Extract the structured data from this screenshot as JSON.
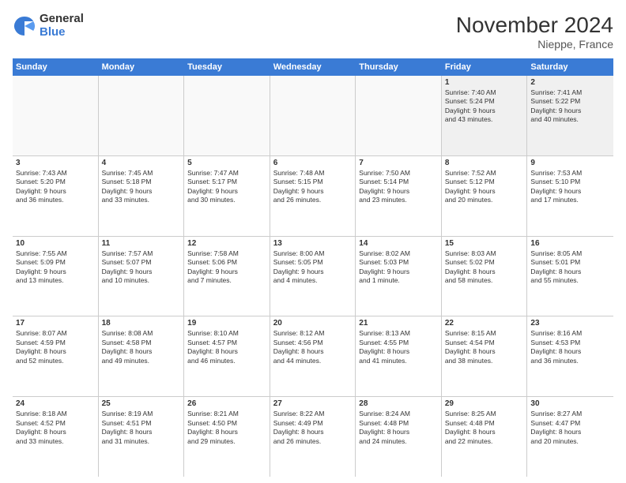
{
  "logo": {
    "general": "General",
    "blue": "Blue"
  },
  "title": "November 2024",
  "subtitle": "Nieppe, France",
  "header": {
    "days": [
      "Sunday",
      "Monday",
      "Tuesday",
      "Wednesday",
      "Thursday",
      "Friday",
      "Saturday"
    ]
  },
  "weeks": [
    {
      "cells": [
        {
          "day": "",
          "info": "",
          "empty": true
        },
        {
          "day": "",
          "info": "",
          "empty": true
        },
        {
          "day": "",
          "info": "",
          "empty": true
        },
        {
          "day": "",
          "info": "",
          "empty": true
        },
        {
          "day": "",
          "info": "",
          "empty": true
        },
        {
          "day": "1",
          "info": "Sunrise: 7:40 AM\nSunset: 5:24 PM\nDaylight: 9 hours\nand 43 minutes.",
          "empty": false
        },
        {
          "day": "2",
          "info": "Sunrise: 7:41 AM\nSunset: 5:22 PM\nDaylight: 9 hours\nand 40 minutes.",
          "empty": false
        }
      ]
    },
    {
      "cells": [
        {
          "day": "3",
          "info": "Sunrise: 7:43 AM\nSunset: 5:20 PM\nDaylight: 9 hours\nand 36 minutes.",
          "empty": false
        },
        {
          "day": "4",
          "info": "Sunrise: 7:45 AM\nSunset: 5:18 PM\nDaylight: 9 hours\nand 33 minutes.",
          "empty": false
        },
        {
          "day": "5",
          "info": "Sunrise: 7:47 AM\nSunset: 5:17 PM\nDaylight: 9 hours\nand 30 minutes.",
          "empty": false
        },
        {
          "day": "6",
          "info": "Sunrise: 7:48 AM\nSunset: 5:15 PM\nDaylight: 9 hours\nand 26 minutes.",
          "empty": false
        },
        {
          "day": "7",
          "info": "Sunrise: 7:50 AM\nSunset: 5:14 PM\nDaylight: 9 hours\nand 23 minutes.",
          "empty": false
        },
        {
          "day": "8",
          "info": "Sunrise: 7:52 AM\nSunset: 5:12 PM\nDaylight: 9 hours\nand 20 minutes.",
          "empty": false
        },
        {
          "day": "9",
          "info": "Sunrise: 7:53 AM\nSunset: 5:10 PM\nDaylight: 9 hours\nand 17 minutes.",
          "empty": false
        }
      ]
    },
    {
      "cells": [
        {
          "day": "10",
          "info": "Sunrise: 7:55 AM\nSunset: 5:09 PM\nDaylight: 9 hours\nand 13 minutes.",
          "empty": false
        },
        {
          "day": "11",
          "info": "Sunrise: 7:57 AM\nSunset: 5:07 PM\nDaylight: 9 hours\nand 10 minutes.",
          "empty": false
        },
        {
          "day": "12",
          "info": "Sunrise: 7:58 AM\nSunset: 5:06 PM\nDaylight: 9 hours\nand 7 minutes.",
          "empty": false
        },
        {
          "day": "13",
          "info": "Sunrise: 8:00 AM\nSunset: 5:05 PM\nDaylight: 9 hours\nand 4 minutes.",
          "empty": false
        },
        {
          "day": "14",
          "info": "Sunrise: 8:02 AM\nSunset: 5:03 PM\nDaylight: 9 hours\nand 1 minute.",
          "empty": false
        },
        {
          "day": "15",
          "info": "Sunrise: 8:03 AM\nSunset: 5:02 PM\nDaylight: 8 hours\nand 58 minutes.",
          "empty": false
        },
        {
          "day": "16",
          "info": "Sunrise: 8:05 AM\nSunset: 5:01 PM\nDaylight: 8 hours\nand 55 minutes.",
          "empty": false
        }
      ]
    },
    {
      "cells": [
        {
          "day": "17",
          "info": "Sunrise: 8:07 AM\nSunset: 4:59 PM\nDaylight: 8 hours\nand 52 minutes.",
          "empty": false
        },
        {
          "day": "18",
          "info": "Sunrise: 8:08 AM\nSunset: 4:58 PM\nDaylight: 8 hours\nand 49 minutes.",
          "empty": false
        },
        {
          "day": "19",
          "info": "Sunrise: 8:10 AM\nSunset: 4:57 PM\nDaylight: 8 hours\nand 46 minutes.",
          "empty": false
        },
        {
          "day": "20",
          "info": "Sunrise: 8:12 AM\nSunset: 4:56 PM\nDaylight: 8 hours\nand 44 minutes.",
          "empty": false
        },
        {
          "day": "21",
          "info": "Sunrise: 8:13 AM\nSunset: 4:55 PM\nDaylight: 8 hours\nand 41 minutes.",
          "empty": false
        },
        {
          "day": "22",
          "info": "Sunrise: 8:15 AM\nSunset: 4:54 PM\nDaylight: 8 hours\nand 38 minutes.",
          "empty": false
        },
        {
          "day": "23",
          "info": "Sunrise: 8:16 AM\nSunset: 4:53 PM\nDaylight: 8 hours\nand 36 minutes.",
          "empty": false
        }
      ]
    },
    {
      "cells": [
        {
          "day": "24",
          "info": "Sunrise: 8:18 AM\nSunset: 4:52 PM\nDaylight: 8 hours\nand 33 minutes.",
          "empty": false
        },
        {
          "day": "25",
          "info": "Sunrise: 8:19 AM\nSunset: 4:51 PM\nDaylight: 8 hours\nand 31 minutes.",
          "empty": false
        },
        {
          "day": "26",
          "info": "Sunrise: 8:21 AM\nSunset: 4:50 PM\nDaylight: 8 hours\nand 29 minutes.",
          "empty": false
        },
        {
          "day": "27",
          "info": "Sunrise: 8:22 AM\nSunset: 4:49 PM\nDaylight: 8 hours\nand 26 minutes.",
          "empty": false
        },
        {
          "day": "28",
          "info": "Sunrise: 8:24 AM\nSunset: 4:48 PM\nDaylight: 8 hours\nand 24 minutes.",
          "empty": false
        },
        {
          "day": "29",
          "info": "Sunrise: 8:25 AM\nSunset: 4:48 PM\nDaylight: 8 hours\nand 22 minutes.",
          "empty": false
        },
        {
          "day": "30",
          "info": "Sunrise: 8:27 AM\nSunset: 4:47 PM\nDaylight: 8 hours\nand 20 minutes.",
          "empty": false
        }
      ]
    }
  ]
}
